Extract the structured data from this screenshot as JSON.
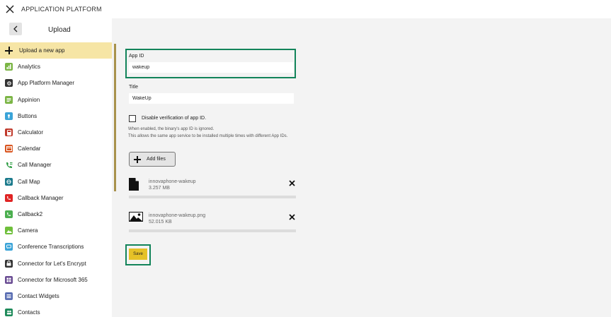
{
  "window": {
    "title": "APPLICATION PLATFORM"
  },
  "sidebar": {
    "title": "Upload",
    "items": [
      {
        "label": "Upload a new app",
        "icon": "plus-icon",
        "active": true
      },
      {
        "label": "Analytics",
        "icon": "analytics-icon",
        "color": "#7bb545"
      },
      {
        "label": "App Platform Manager",
        "icon": "app-platform-manager-icon",
        "color": "#333333"
      },
      {
        "label": "Appinion",
        "icon": "appinion-icon",
        "color": "#7bb545"
      },
      {
        "label": "Buttons",
        "icon": "buttons-icon",
        "color": "#3ba4d8"
      },
      {
        "label": "Calculator",
        "icon": "calculator-icon",
        "color": "#c0392b"
      },
      {
        "label": "Calendar",
        "icon": "calendar-icon",
        "color": "#d9541e"
      },
      {
        "label": "Call Manager",
        "icon": "call-manager-icon",
        "color": "#2e7d32"
      },
      {
        "label": "Call Map",
        "icon": "call-map-icon",
        "color": "#1b7a8c"
      },
      {
        "label": "Callback Manager",
        "icon": "callback-manager-icon",
        "color": "#e02424"
      },
      {
        "label": "Callback2",
        "icon": "callback2-icon",
        "color": "#4caf50"
      },
      {
        "label": "Camera",
        "icon": "camera-icon",
        "color": "#6fbf3b"
      },
      {
        "label": "Conference Transcriptions",
        "icon": "conference-transcriptions-icon",
        "color": "#3ba4d8"
      },
      {
        "label": "Connector for Let's Encrypt",
        "icon": "lets-encrypt-icon",
        "color": "#333333"
      },
      {
        "label": "Connector for Microsoft 365",
        "icon": "microsoft-365-icon",
        "color": "#6a4c93"
      },
      {
        "label": "Contact Widgets",
        "icon": "contact-widgets-icon",
        "color": "#5b6fb3"
      },
      {
        "label": "Contacts",
        "icon": "contacts-icon",
        "color": "#1e8a5a"
      }
    ]
  },
  "form": {
    "app_id": {
      "label": "App ID",
      "value": "wakeup"
    },
    "title": {
      "label": "Title",
      "value": "WakeUp"
    },
    "verify": {
      "label": "Disable verification of app ID.",
      "checked": false,
      "help_line1": "When enabled, the binary's app ID is ignored.",
      "help_line2": "This allows the same app service to be installed multiple times with different App IDs."
    },
    "add_files_label": "Add files",
    "files": [
      {
        "name": "innovaphone-wakeup",
        "size": "3.257 MB",
        "icon": "file-icon"
      },
      {
        "name": "innovaphone-wakeup.png",
        "size": "52.015 KB",
        "icon": "image-icon"
      }
    ],
    "save_label": "Save"
  },
  "colors": {
    "active_item": "#f6e5a5",
    "highlight": "#12845a",
    "save_button": "#e5c227",
    "divider": "#a8924c"
  }
}
